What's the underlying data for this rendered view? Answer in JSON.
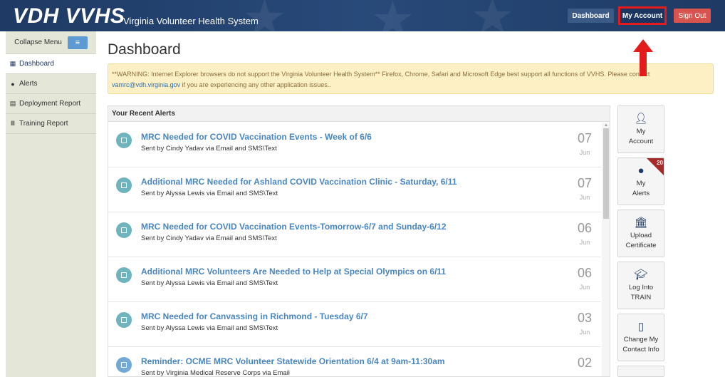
{
  "header": {
    "brand": "VDH VVHS",
    "subtitle": "Virginia Volunteer Health System",
    "dashboard_btn": "Dashboard",
    "account_btn": "My Account",
    "signout_btn": "Sign Out"
  },
  "sidebar": {
    "collapse_label": "Collapse Menu",
    "collapse_icon": "menu-icon",
    "items": [
      {
        "label": "Dashboard",
        "icon": "grid-icon",
        "active": true
      },
      {
        "label": "Alerts",
        "icon": "comment-icon"
      },
      {
        "label": "Deployment Report",
        "icon": "calendar-icon"
      },
      {
        "label": "Training Report",
        "icon": "institution-icon"
      }
    ]
  },
  "main": {
    "title": "Dashboard",
    "warning_text": "**WARNING: Internet Explorer browsers do not support the Virginia Volunteer Health System** Firefox, Chrome, Safari and Microsoft Edge best support all functions of VVHS. Please contact",
    "warning_email": "vamrc@vdh.virginia.gov",
    "warning_tail": " if you are experiencing any other application issues.."
  },
  "alerts_panel": {
    "heading": "Your Recent Alerts",
    "alerts": [
      {
        "title": "MRC Needed for COVID Vaccination Events - Week of 6/6",
        "sender": "Sent by Cindy Yadav via Email and SMS\\Text",
        "day": "07",
        "month": "Jun"
      },
      {
        "title": "Additional MRC Needed for Ashland COVID Vaccination Clinic - Saturday, 6/11",
        "sender": "Sent by Alyssa Lewis via Email and SMS\\Text",
        "day": "07",
        "month": "Jun"
      },
      {
        "title": "MRC Needed for COVID Vaccination Events-Tomorrow-6/7 and Sunday-6/12",
        "sender": "Sent by Cindy Yadav via Email and SMS\\Text",
        "day": "06",
        "month": "Jun"
      },
      {
        "title": "Additional MRC Volunteers Are Needed to Help at Special Olympics on 6/11",
        "sender": "Sent by Alyssa Lewis via Email and SMS\\Text",
        "day": "06",
        "month": "Jun"
      },
      {
        "title": "MRC Needed for Canvassing in Richmond - Tuesday 6/7",
        "sender": "Sent by Alyssa Lewis via Email and SMS\\Text",
        "day": "03",
        "month": "Jun"
      },
      {
        "title": "Reminder: OCME MRC Volunteer Statewide Orientation 6/4 at 9am-11:30am",
        "sender": "Sent by Virginia Medical Reserve Corps via Email",
        "day": "02",
        "month": ""
      }
    ]
  },
  "tiles": [
    {
      "line1": "My",
      "line2": "Account",
      "icon": "user-icon"
    },
    {
      "line1": "My",
      "line2": "Alerts",
      "icon": "comment-icon",
      "badge": "20"
    },
    {
      "line1": "Upload",
      "line2": "Certificate",
      "icon": "institution-icon"
    },
    {
      "line1": "Log Into",
      "line2": "TRAIN",
      "icon": "graduation-cap-icon"
    },
    {
      "line1": "Change My",
      "line2": "Contact Info",
      "icon": "mobile-phone-icon"
    }
  ],
  "colors": {
    "header": "#1f3a64",
    "accent_link": "#4a86c2",
    "sign_out": "#d9534f",
    "highlight": "#e41b1b"
  }
}
